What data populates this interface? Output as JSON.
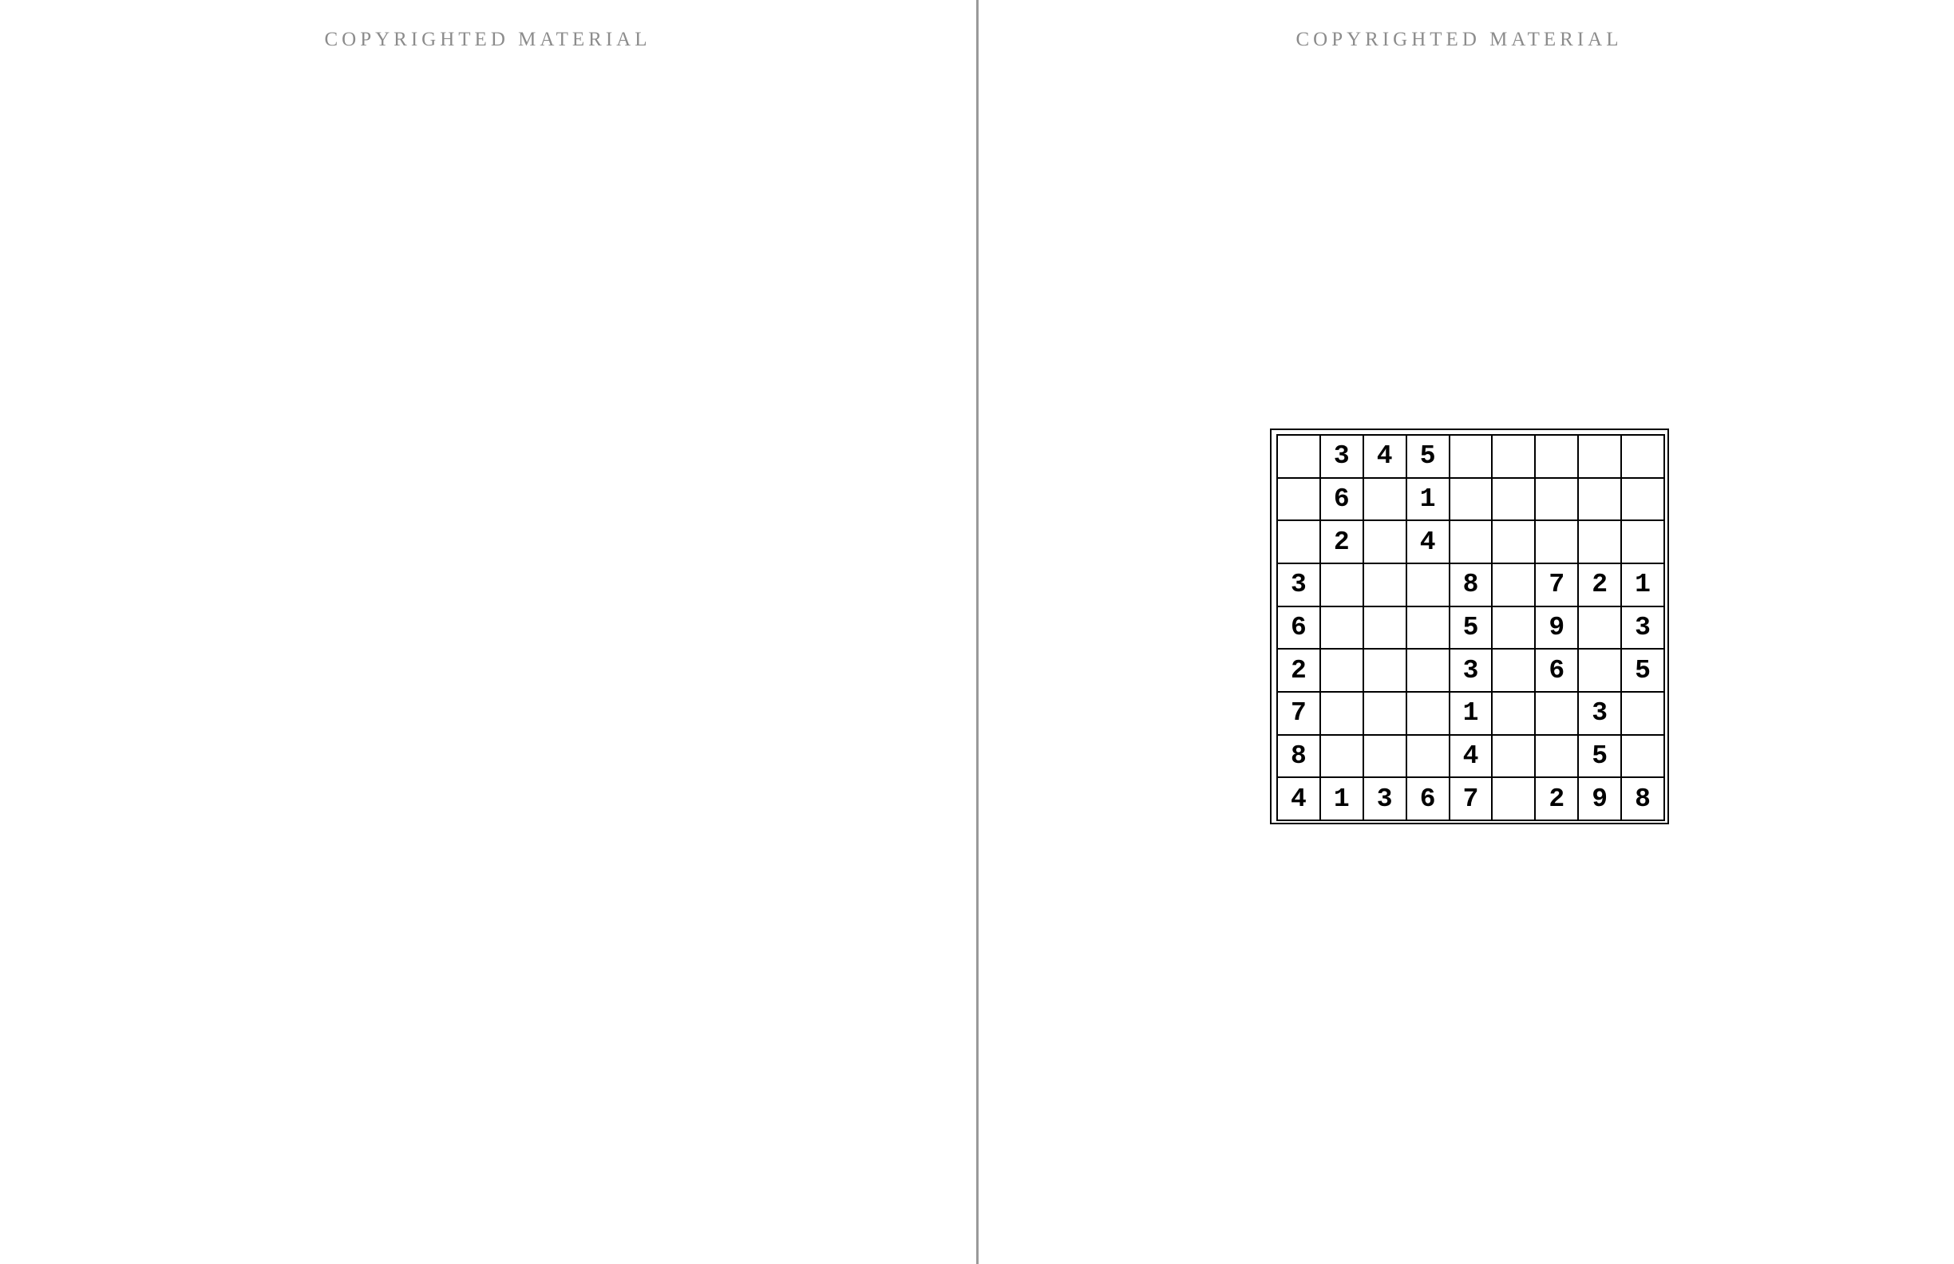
{
  "left_page": {
    "header": "COPYRIGHTED MATERIAL"
  },
  "right_page": {
    "header": "COPYRIGHTED MATERIAL"
  },
  "puzzle": {
    "rows": [
      [
        "",
        "3",
        "4",
        "5",
        "",
        "",
        "",
        "",
        ""
      ],
      [
        "",
        "6",
        "",
        "1",
        "",
        "",
        "",
        "",
        ""
      ],
      [
        "",
        "2",
        "",
        "4",
        "",
        "",
        "",
        "",
        ""
      ],
      [
        "3",
        "",
        "",
        "",
        "8",
        "",
        "7",
        "2",
        "1"
      ],
      [
        "6",
        "",
        "",
        "",
        "5",
        "",
        "9",
        "",
        "3"
      ],
      [
        "2",
        "",
        "",
        "",
        "3",
        "",
        "6",
        "",
        "5"
      ],
      [
        "7",
        "",
        "",
        "",
        "1",
        "",
        "",
        "3",
        ""
      ],
      [
        "8",
        "",
        "",
        "",
        "4",
        "",
        "",
        "5",
        ""
      ],
      [
        "4",
        "1",
        "3",
        "6",
        "7",
        "",
        "2",
        "9",
        "8"
      ]
    ]
  }
}
